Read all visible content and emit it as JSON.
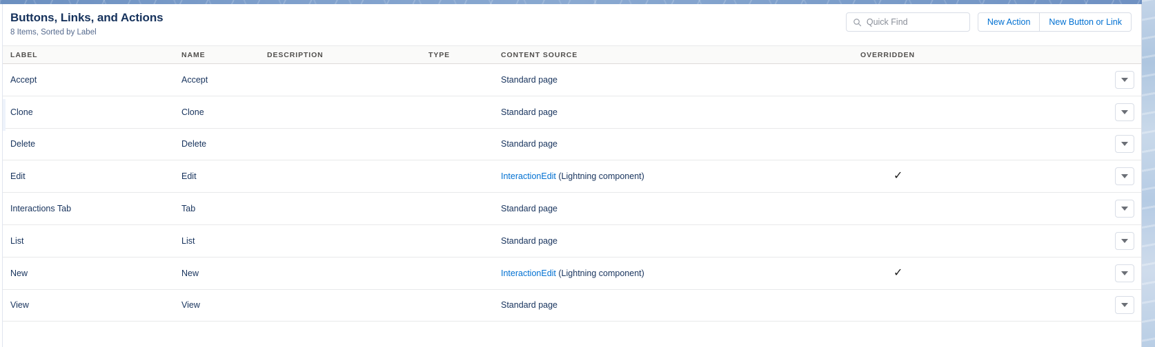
{
  "header": {
    "title": "Buttons, Links, and Actions",
    "subtitle": "8 Items, Sorted by Label",
    "search": {
      "placeholder": "Quick Find",
      "value": "",
      "icon": "search-icon"
    },
    "buttons": [
      {
        "label": "New Action",
        "name": "new-action-button"
      },
      {
        "label": "New Button or Link",
        "name": "new-button-or-link-button"
      }
    ]
  },
  "table": {
    "columns": [
      {
        "key": "label",
        "label": "LABEL"
      },
      {
        "key": "name",
        "label": "NAME"
      },
      {
        "key": "description",
        "label": "DESCRIPTION"
      },
      {
        "key": "type",
        "label": "TYPE"
      },
      {
        "key": "content_source",
        "label": "CONTENT SOURCE"
      },
      {
        "key": "overridden",
        "label": "OVERRIDDEN"
      },
      {
        "key": "menu",
        "label": ""
      }
    ],
    "rows": [
      {
        "label": "Accept",
        "name": "Accept",
        "description": "",
        "type": "",
        "source_link": "",
        "source_text": "Standard page",
        "overridden": ""
      },
      {
        "label": "Clone",
        "name": "Clone",
        "description": "",
        "type": "",
        "source_link": "",
        "source_text": "Standard page",
        "overridden": ""
      },
      {
        "label": "Delete",
        "name": "Delete",
        "description": "",
        "type": "",
        "source_link": "",
        "source_text": "Standard page",
        "overridden": ""
      },
      {
        "label": "Edit",
        "name": "Edit",
        "description": "",
        "type": "",
        "source_link": "InteractionEdit",
        "source_text": " (Lightning component)",
        "overridden": "✓"
      },
      {
        "label": "Interactions Tab",
        "name": "Tab",
        "description": "",
        "type": "",
        "source_link": "",
        "source_text": "Standard page",
        "overridden": ""
      },
      {
        "label": "List",
        "name": "List",
        "description": "",
        "type": "",
        "source_link": "",
        "source_text": "Standard page",
        "overridden": ""
      },
      {
        "label": "New",
        "name": "New",
        "description": "",
        "type": "",
        "source_link": "InteractionEdit",
        "source_text": " (Lightning component)",
        "overridden": "✓"
      },
      {
        "label": "View",
        "name": "View",
        "description": "",
        "type": "",
        "source_link": "",
        "source_text": "Standard page",
        "overridden": ""
      }
    ],
    "row_menu_icon": "chevron-down-icon"
  },
  "colors": {
    "link": "#0070d2",
    "text": "#16325c",
    "header_bg": "#fafaf9",
    "border": "#e8e9ea"
  }
}
